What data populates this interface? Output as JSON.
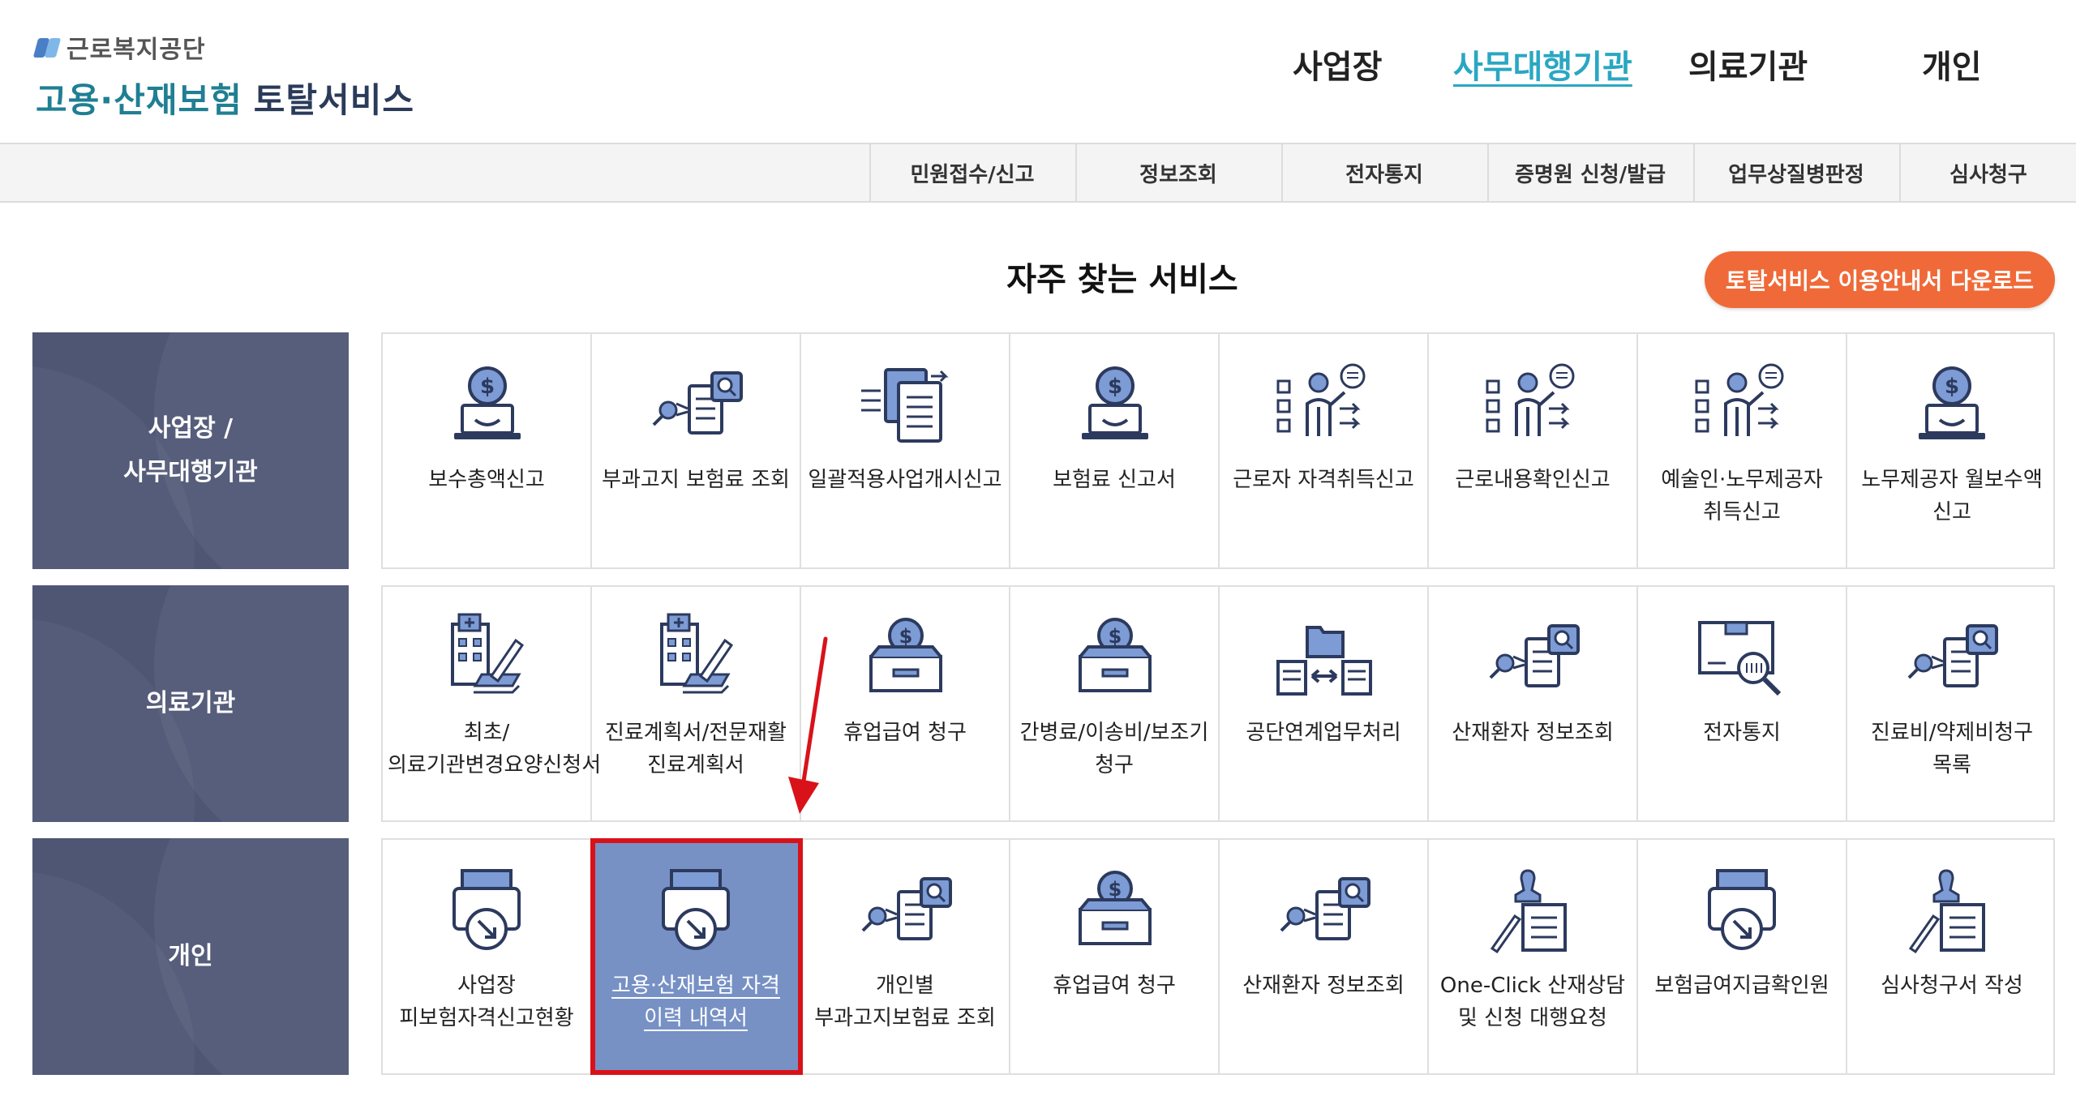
{
  "header": {
    "org_name": "근로복지공단",
    "service_title_part1": "고용·산재보험",
    "service_title_part2": "토탈서비스",
    "nav": [
      {
        "label": "사업장"
      },
      {
        "label": "사무대행기관",
        "active": true
      },
      {
        "label": "의료기관"
      },
      {
        "label": "개인"
      }
    ]
  },
  "subnav": {
    "items": [
      "민원접수/신고",
      "정보조회",
      "전자통지",
      "증명원 신청/발급",
      "업무상질병판정",
      "심사청구"
    ]
  },
  "main": {
    "section_title": "자주 찾는 서비스",
    "download_button": "토탈서비스 이용안내서 다운로드",
    "rows": [
      {
        "category": "사업장 /\n사무대행기관",
        "tiles": [
          {
            "label": "보수총액신고",
            "icon": "money-laptop-icon"
          },
          {
            "label": "부과고지 보험료 조회",
            "icon": "document-search-icon"
          },
          {
            "label": "일괄적용사업개시신고",
            "icon": "document-list-icon"
          },
          {
            "label": "보험료 신고서",
            "icon": "money-laptop-icon"
          },
          {
            "label": "근로자 자격취득신고",
            "icon": "person-checklist-icon"
          },
          {
            "label": "근로내용확인신고",
            "icon": "person-checklist-icon"
          },
          {
            "label": "예술인·노무제공자 취득신고",
            "icon": "person-checklist-icon"
          },
          {
            "label": "노무제공자 월보수액 신고",
            "icon": "money-laptop-icon"
          }
        ]
      },
      {
        "category": "의료기관",
        "tiles": [
          {
            "label": "최초/의료기관변경요양신청서",
            "icon": "hospital-pen-icon"
          },
          {
            "label": "진료계획서/전문재활 진료계획서",
            "icon": "hospital-pen-icon"
          },
          {
            "label": "휴업급여 청구",
            "icon": "coin-box-icon"
          },
          {
            "label": "간병료/이송비/보조기 청구",
            "icon": "coin-box-icon"
          },
          {
            "label": "공단연계업무처리",
            "icon": "folder-exchange-icon"
          },
          {
            "label": "산재환자 정보조회",
            "icon": "document-search-icon"
          },
          {
            "label": "전자통지",
            "icon": "box-magnifier-icon"
          },
          {
            "label": "진료비/약제비청구 목록",
            "icon": "document-search-icon"
          }
        ]
      },
      {
        "category": "개인",
        "tiles": [
          {
            "label": "사업장 피보험자격신고현황",
            "icon": "printer-arrow-icon"
          },
          {
            "label": "고용·산재보험 자격 이력 내역서",
            "icon": "printer-arrow-icon",
            "highlighted": true
          },
          {
            "label": "개인별 부과고지보험료 조회",
            "icon": "document-search-icon"
          },
          {
            "label": "휴업급여 청구",
            "icon": "coin-box-icon"
          },
          {
            "label": "산재환자 정보조회",
            "icon": "document-search-icon"
          },
          {
            "label": "One-Click 산재상담 및 신청 대행요청",
            "icon": "stamp-document-icon"
          },
          {
            "label": "보험급여지급확인원",
            "icon": "printer-arrow-icon"
          },
          {
            "label": "심사청구서 작성",
            "icon": "stamp-document-icon"
          }
        ]
      }
    ]
  },
  "colors": {
    "accent": "#2aa7c2",
    "category_bg": "#4f5674",
    "highlight_bg": "#7791c5",
    "highlight_border": "#d9121a",
    "download_btn": "#ef6a38",
    "icon_stroke": "#2c3a5e",
    "icon_fill": "#7d9bd4"
  }
}
